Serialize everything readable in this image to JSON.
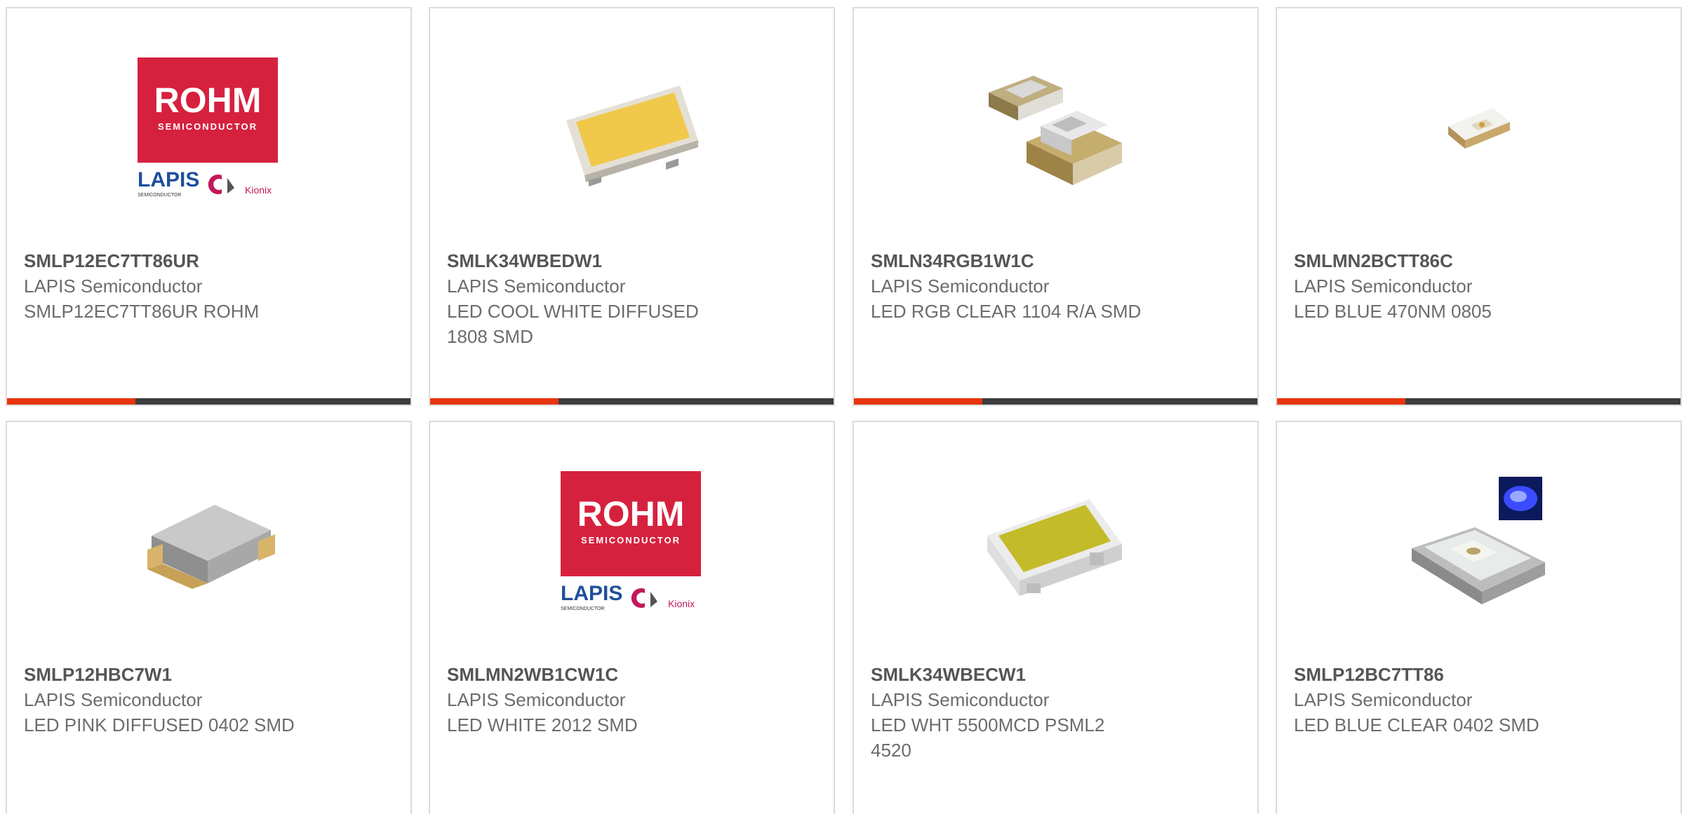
{
  "colors": {
    "accent": "#e8340f",
    "bar": "#3d3d3d",
    "border": "#dcdcdc",
    "rohm_red": "#d6213e",
    "lapis_blue": "#1f4f9c"
  },
  "products": [
    {
      "part": "SMLP12EC7TT86UR",
      "manufacturer": "LAPIS Semiconductor",
      "description": "SMLP12EC7TT86UR ROHM",
      "image": "rohm-logo",
      "logo": {
        "brand": "ROHM",
        "sub": "SEMICONDUCTOR",
        "lapis": "LAPIS",
        "lapis_sub": "SEMICONDUCTOR",
        "kionix": "Kionix"
      }
    },
    {
      "part": "SMLK34WBEDW1",
      "manufacturer": "LAPIS Semiconductor",
      "description": "LED COOL WHITE DIFFUSED 1808 SMD",
      "image": "led-yellow-top"
    },
    {
      "part": "SMLN34RGB1W1C",
      "manufacturer": "LAPIS Semiconductor",
      "description": "LED RGB CLEAR 1104 R/A SMD",
      "image": "led-rgb-pair"
    },
    {
      "part": "SMLMN2BCTT86C",
      "manufacturer": "LAPIS Semiconductor",
      "description": "LED BLUE 470NM 0805",
      "image": "led-small-chip"
    },
    {
      "part": "SMLP12HBC7W1",
      "manufacturer": "LAPIS Semiconductor",
      "description": "LED PINK DIFFUSED 0402 SMD",
      "image": "led-gray-chip"
    },
    {
      "part": "SMLMN2WB1CW1C",
      "manufacturer": "LAPIS Semiconductor",
      "description": "LED WHITE 2012 SMD",
      "image": "rohm-logo",
      "logo": {
        "brand": "ROHM",
        "sub": "SEMICONDUCTOR",
        "lapis": "LAPIS",
        "lapis_sub": "SEMICONDUCTOR",
        "kionix": "Kionix"
      }
    },
    {
      "part": "SMLK34WBECW1",
      "manufacturer": "LAPIS Semiconductor",
      "description": "LED WHT 5500MCD PSML2 4520",
      "image": "led-olive-top"
    },
    {
      "part": "SMLP12BC7TT86",
      "manufacturer": "LAPIS Semiconductor",
      "description": "LED BLUE CLEAR 0402 SMD",
      "image": "led-blue-glow"
    }
  ]
}
